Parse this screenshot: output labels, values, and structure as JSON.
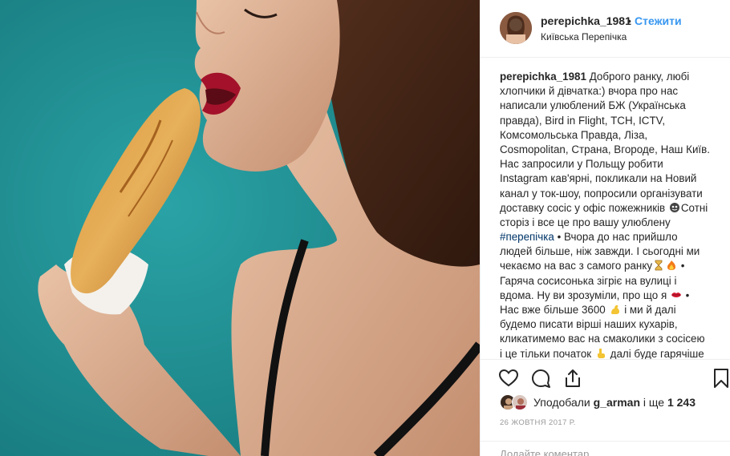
{
  "post": {
    "username": "perepichka_1981",
    "separator": "•",
    "follow_label": "Стежити",
    "location": "Київська Перепічка"
  },
  "caption": {
    "username": "perepichka_1981",
    "lines": [
      "Доброго ранку, любі",
      "хлопчики й дівчатка:) вчора про нас",
      "написали улюблений БЖ (Українська",
      "правда), Bird in Flight, ТСН, ICTV,",
      "Комсомольська Правда, Ліза,",
      "Cosmopolitan, Страна, Вгороде, Наш Київ.",
      "Нас запросили у Польщу робити",
      "Instagram кав'ярні, покликали на Новий",
      "канал у ток-шоу, попросили організувати",
      "доставку сосіс у офіс пожежників",
      "Сотні",
      "сторіз і все це про вашу улюблену",
      "#перепічка",
      " • Вчора до нас прийшло",
      "людей більше, ніж завжди. І сьогодні ми",
      "чекаємо на вас з самого ранку",
      " •",
      "Гаряча сосисонька зігріє на вулиці і",
      "вдома. Ну ви зрозуміли, про що я",
      " •",
      "Нас вже більше 3600",
      " і ми й далі",
      "будемо писати вірші наших кухарів,",
      "кликатимемо вас на смаколики з сосісею",
      "і це тільки початок",
      " далі буде гарячіше"
    ]
  },
  "icons": {
    "like": "heart-icon",
    "comment": "comment-icon",
    "share": "share-icon",
    "save": "bookmark-icon"
  },
  "likes": {
    "prefix": "Уподобали",
    "user": "g_arman",
    "suffix": "і ще",
    "count": "1 243"
  },
  "date": "26 ЖОВТНЯ 2017 Р.",
  "comment": {
    "placeholder": "Додайте коментар..."
  },
  "colors": {
    "accent": "#3897f0",
    "hashtag": "#003569",
    "photo_background": "#1d8f94"
  }
}
